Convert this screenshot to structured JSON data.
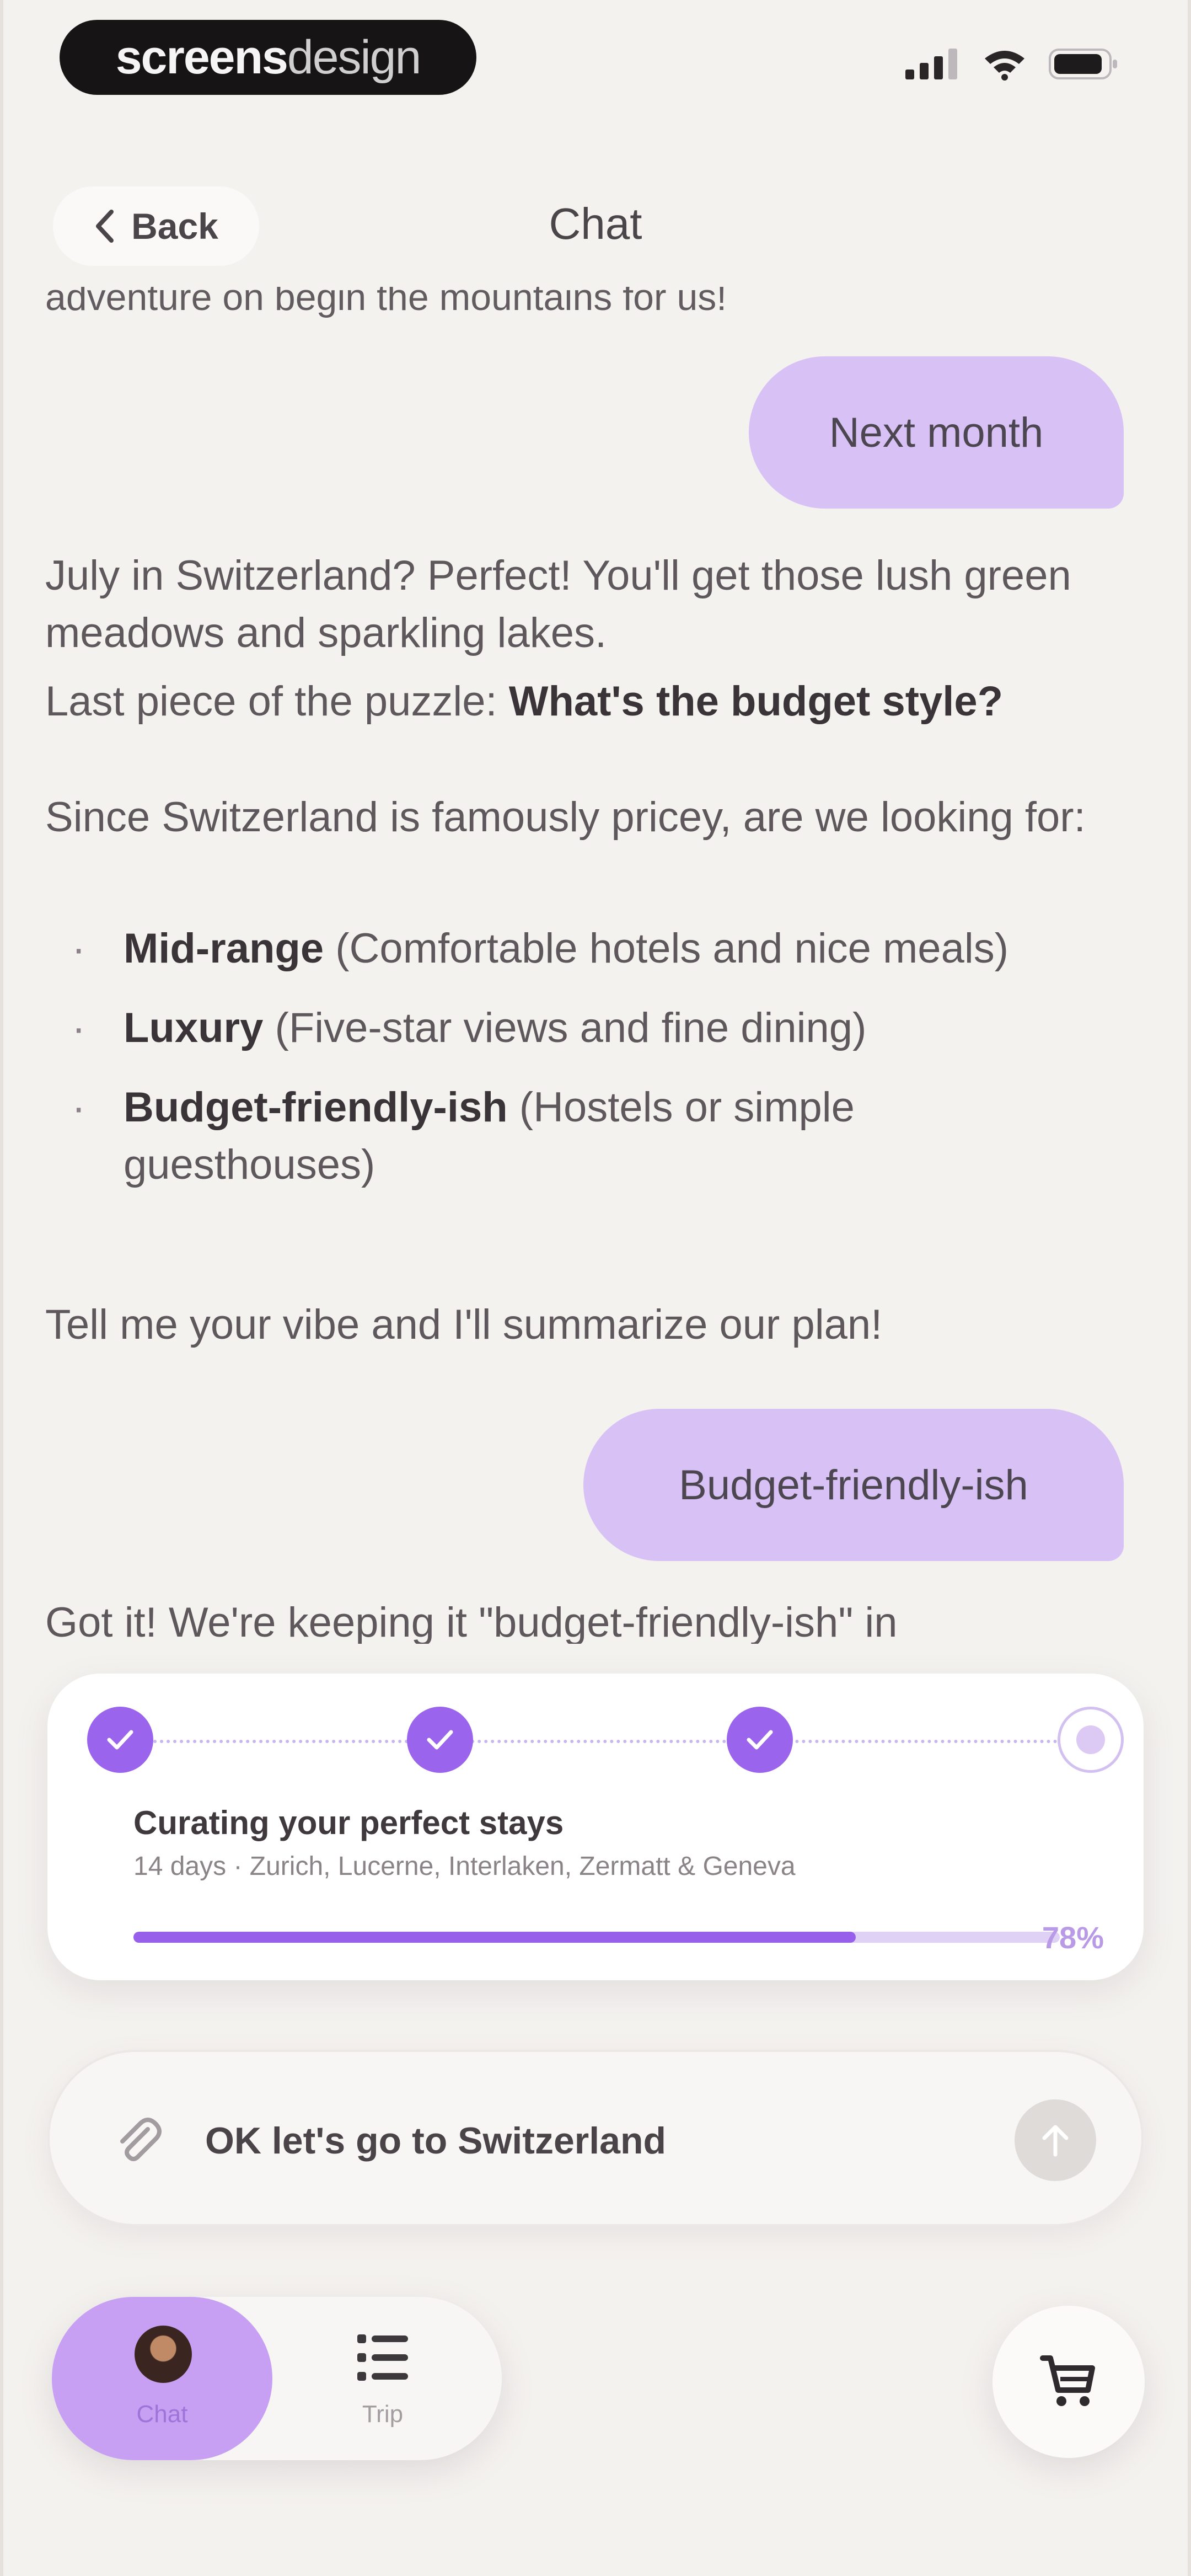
{
  "status_bar": {
    "brand_bold": "screens",
    "brand_light": "design"
  },
  "header": {
    "back_label": "Back",
    "title": "Chat"
  },
  "chat": {
    "clipped_line": "adventure on begin the mountains for us!",
    "messages": {
      "user_1": "Next month",
      "bot_1_p1": "July in Switzerland? Perfect! You'll get those lush green meadows and sparkling lakes.",
      "bot_1_p2_prefix": "Last piece of the puzzle: ",
      "bot_1_p2_bold": "What's the budget style?",
      "bot_1_p3": "Since Switzerland is famously pricey, are we looking for:",
      "options": [
        {
          "name": "Mid-range",
          "desc": " (Comfortable hotels and nice meals)"
        },
        {
          "name": "Luxury",
          "desc": " (Five-star views and fine dining)"
        },
        {
          "name": "Budget-friendly-ish",
          "desc": " (Hostels or simple guesthouses)"
        }
      ],
      "bot_1_p4": "Tell me your vibe and I'll summarize our plan!",
      "user_2": "Budget-friendly-ish",
      "bot_2": "Got it! We're keeping it \"budget-friendly-ish\" in"
    }
  },
  "progress": {
    "title": "Curating your perfect stays",
    "subtitle": "14 days · Zurich, Lucerne, Interlaken, Zermatt & Geneva",
    "percent_label": "78%",
    "fraction": 0.78,
    "steps_completed": 3,
    "steps_total": 4
  },
  "composer": {
    "value": "OK let's go to Switzerland"
  },
  "nav": {
    "chat_label": "Chat",
    "trip_label": "Trip"
  },
  "colors": {
    "accent": "#9a64ec",
    "user_bubble": "#d8c1f5",
    "background": "#f4f2ef"
  },
  "icons": {
    "back": "chevron-left-icon",
    "attach": "paperclip-icon",
    "send": "arrow-up-icon",
    "trip": "list-icon",
    "cart": "cart-icon"
  }
}
